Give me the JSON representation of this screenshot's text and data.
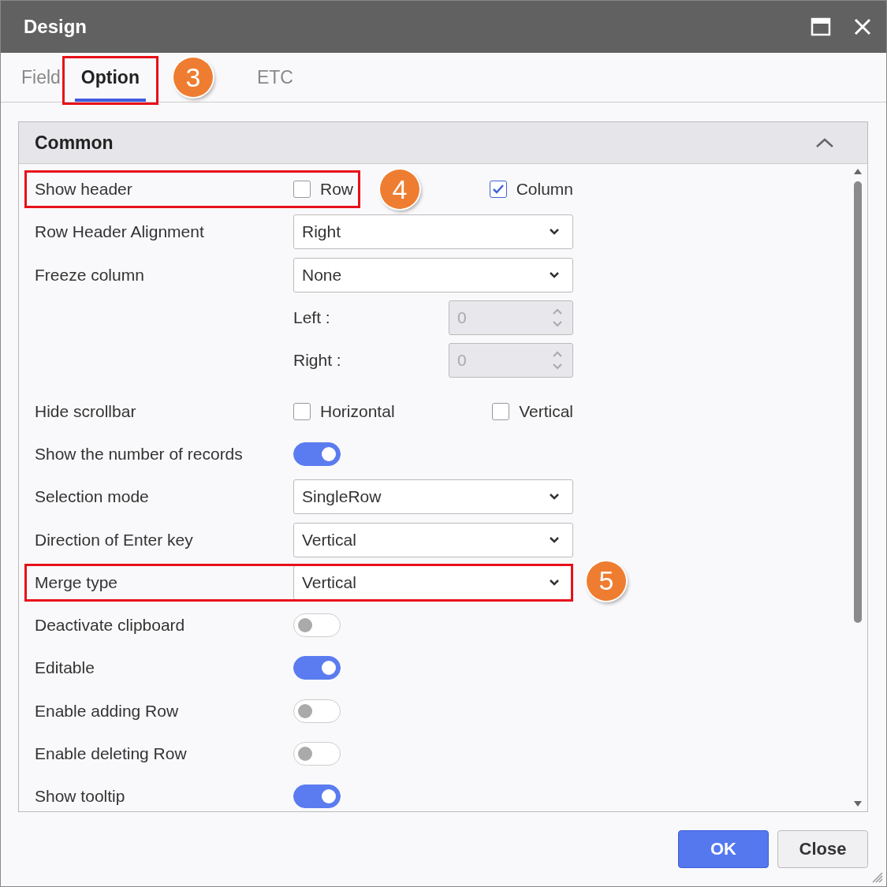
{
  "window": {
    "title": "Design"
  },
  "tabs": [
    {
      "label": "Field",
      "selected": false,
      "highlighted": false
    },
    {
      "label": "Option",
      "selected": true,
      "highlighted": true,
      "callout": "3"
    },
    {
      "label": "ETC",
      "selected": false,
      "highlighted": false
    }
  ],
  "section": {
    "title": "Common",
    "expanded": true,
    "rows": [
      {
        "kind": "checks",
        "label": "Show header",
        "highlighted": true,
        "callout": "4",
        "options": [
          {
            "label": "Row",
            "checked": false
          },
          {
            "label": "Column",
            "checked": true
          }
        ]
      },
      {
        "kind": "select",
        "label": "Row Header Alignment",
        "value": "Right"
      },
      {
        "kind": "select",
        "label": "Freeze column",
        "value": "None"
      },
      {
        "kind": "spinner",
        "sublabel": "Left :",
        "value": "0",
        "disabled": true
      },
      {
        "kind": "spinner",
        "sublabel": "Right :",
        "value": "0",
        "disabled": true
      },
      {
        "kind": "checks",
        "label": "Hide scrollbar",
        "options": [
          {
            "label": "Horizontal",
            "checked": false
          },
          {
            "label": "Vertical",
            "checked": false
          }
        ]
      },
      {
        "kind": "toggle",
        "label": "Show the number of records",
        "on": true
      },
      {
        "kind": "select",
        "label": "Selection mode",
        "value": "SingleRow"
      },
      {
        "kind": "select",
        "label": "Direction of Enter key",
        "value": "Vertical"
      },
      {
        "kind": "select",
        "label": "Merge type",
        "value": "Vertical",
        "highlighted": true,
        "callout": "5"
      },
      {
        "kind": "toggle",
        "label": "Deactivate clipboard",
        "on": false
      },
      {
        "kind": "toggle",
        "label": "Editable",
        "on": true
      },
      {
        "kind": "toggle",
        "label": "Enable adding Row",
        "on": false
      },
      {
        "kind": "toggle",
        "label": "Enable deleting Row",
        "on": false
      },
      {
        "kind": "toggle",
        "label": "Show tooltip",
        "on": true
      }
    ]
  },
  "buttons": [
    {
      "label": "OK",
      "primary": true
    },
    {
      "label": "Close",
      "primary": false
    }
  ]
}
